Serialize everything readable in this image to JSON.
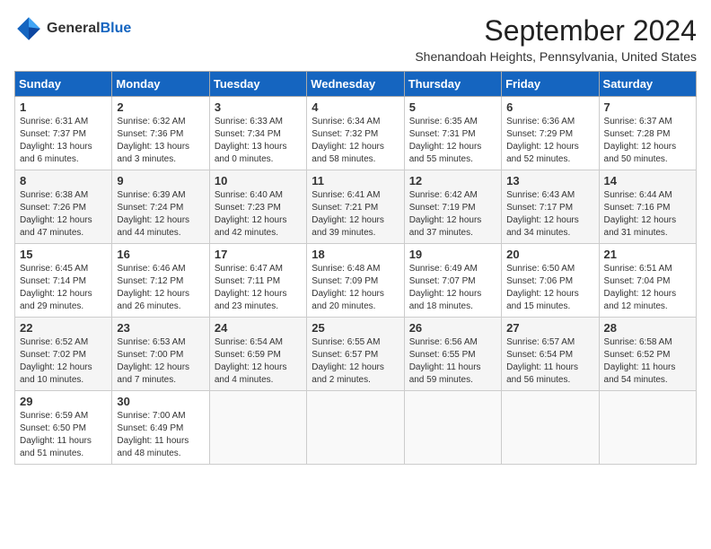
{
  "header": {
    "logo_general": "General",
    "logo_blue": "Blue",
    "month_title": "September 2024",
    "location": "Shenandoah Heights, Pennsylvania, United States"
  },
  "weekdays": [
    "Sunday",
    "Monday",
    "Tuesday",
    "Wednesday",
    "Thursday",
    "Friday",
    "Saturday"
  ],
  "weeks": [
    [
      {
        "day": "1",
        "sunrise": "6:31 AM",
        "sunset": "7:37 PM",
        "daylight": "13 hours and 6 minutes."
      },
      {
        "day": "2",
        "sunrise": "6:32 AM",
        "sunset": "7:36 PM",
        "daylight": "13 hours and 3 minutes."
      },
      {
        "day": "3",
        "sunrise": "6:33 AM",
        "sunset": "7:34 PM",
        "daylight": "13 hours and 0 minutes."
      },
      {
        "day": "4",
        "sunrise": "6:34 AM",
        "sunset": "7:32 PM",
        "daylight": "12 hours and 58 minutes."
      },
      {
        "day": "5",
        "sunrise": "6:35 AM",
        "sunset": "7:31 PM",
        "daylight": "12 hours and 55 minutes."
      },
      {
        "day": "6",
        "sunrise": "6:36 AM",
        "sunset": "7:29 PM",
        "daylight": "12 hours and 52 minutes."
      },
      {
        "day": "7",
        "sunrise": "6:37 AM",
        "sunset": "7:28 PM",
        "daylight": "12 hours and 50 minutes."
      }
    ],
    [
      {
        "day": "8",
        "sunrise": "6:38 AM",
        "sunset": "7:26 PM",
        "daylight": "12 hours and 47 minutes."
      },
      {
        "day": "9",
        "sunrise": "6:39 AM",
        "sunset": "7:24 PM",
        "daylight": "12 hours and 44 minutes."
      },
      {
        "day": "10",
        "sunrise": "6:40 AM",
        "sunset": "7:23 PM",
        "daylight": "12 hours and 42 minutes."
      },
      {
        "day": "11",
        "sunrise": "6:41 AM",
        "sunset": "7:21 PM",
        "daylight": "12 hours and 39 minutes."
      },
      {
        "day": "12",
        "sunrise": "6:42 AM",
        "sunset": "7:19 PM",
        "daylight": "12 hours and 37 minutes."
      },
      {
        "day": "13",
        "sunrise": "6:43 AM",
        "sunset": "7:17 PM",
        "daylight": "12 hours and 34 minutes."
      },
      {
        "day": "14",
        "sunrise": "6:44 AM",
        "sunset": "7:16 PM",
        "daylight": "12 hours and 31 minutes."
      }
    ],
    [
      {
        "day": "15",
        "sunrise": "6:45 AM",
        "sunset": "7:14 PM",
        "daylight": "12 hours and 29 minutes."
      },
      {
        "day": "16",
        "sunrise": "6:46 AM",
        "sunset": "7:12 PM",
        "daylight": "12 hours and 26 minutes."
      },
      {
        "day": "17",
        "sunrise": "6:47 AM",
        "sunset": "7:11 PM",
        "daylight": "12 hours and 23 minutes."
      },
      {
        "day": "18",
        "sunrise": "6:48 AM",
        "sunset": "7:09 PM",
        "daylight": "12 hours and 20 minutes."
      },
      {
        "day": "19",
        "sunrise": "6:49 AM",
        "sunset": "7:07 PM",
        "daylight": "12 hours and 18 minutes."
      },
      {
        "day": "20",
        "sunrise": "6:50 AM",
        "sunset": "7:06 PM",
        "daylight": "12 hours and 15 minutes."
      },
      {
        "day": "21",
        "sunrise": "6:51 AM",
        "sunset": "7:04 PM",
        "daylight": "12 hours and 12 minutes."
      }
    ],
    [
      {
        "day": "22",
        "sunrise": "6:52 AM",
        "sunset": "7:02 PM",
        "daylight": "12 hours and 10 minutes."
      },
      {
        "day": "23",
        "sunrise": "6:53 AM",
        "sunset": "7:00 PM",
        "daylight": "12 hours and 7 minutes."
      },
      {
        "day": "24",
        "sunrise": "6:54 AM",
        "sunset": "6:59 PM",
        "daylight": "12 hours and 4 minutes."
      },
      {
        "day": "25",
        "sunrise": "6:55 AM",
        "sunset": "6:57 PM",
        "daylight": "12 hours and 2 minutes."
      },
      {
        "day": "26",
        "sunrise": "6:56 AM",
        "sunset": "6:55 PM",
        "daylight": "11 hours and 59 minutes."
      },
      {
        "day": "27",
        "sunrise": "6:57 AM",
        "sunset": "6:54 PM",
        "daylight": "11 hours and 56 minutes."
      },
      {
        "day": "28",
        "sunrise": "6:58 AM",
        "sunset": "6:52 PM",
        "daylight": "11 hours and 54 minutes."
      }
    ],
    [
      {
        "day": "29",
        "sunrise": "6:59 AM",
        "sunset": "6:50 PM",
        "daylight": "11 hours and 51 minutes."
      },
      {
        "day": "30",
        "sunrise": "7:00 AM",
        "sunset": "6:49 PM",
        "daylight": "11 hours and 48 minutes."
      },
      null,
      null,
      null,
      null,
      null
    ]
  ]
}
